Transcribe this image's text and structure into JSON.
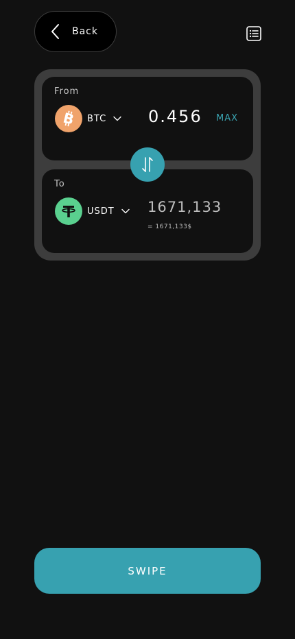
{
  "header": {
    "back_label": "Back"
  },
  "swap": {
    "from": {
      "title": "From",
      "token": "BTC",
      "amount": "0.456",
      "max_label": "MAX"
    },
    "to": {
      "title": "To",
      "token": "USDT",
      "amount": "1671,133",
      "usd_value": "= 1671,133$"
    }
  },
  "action": {
    "label": "SWIPE"
  },
  "colors": {
    "accent": "#37a1b0",
    "btc": "#f0a36b",
    "usdt": "#5ad08f",
    "card": "#3d3d3d",
    "background": "#111111"
  }
}
